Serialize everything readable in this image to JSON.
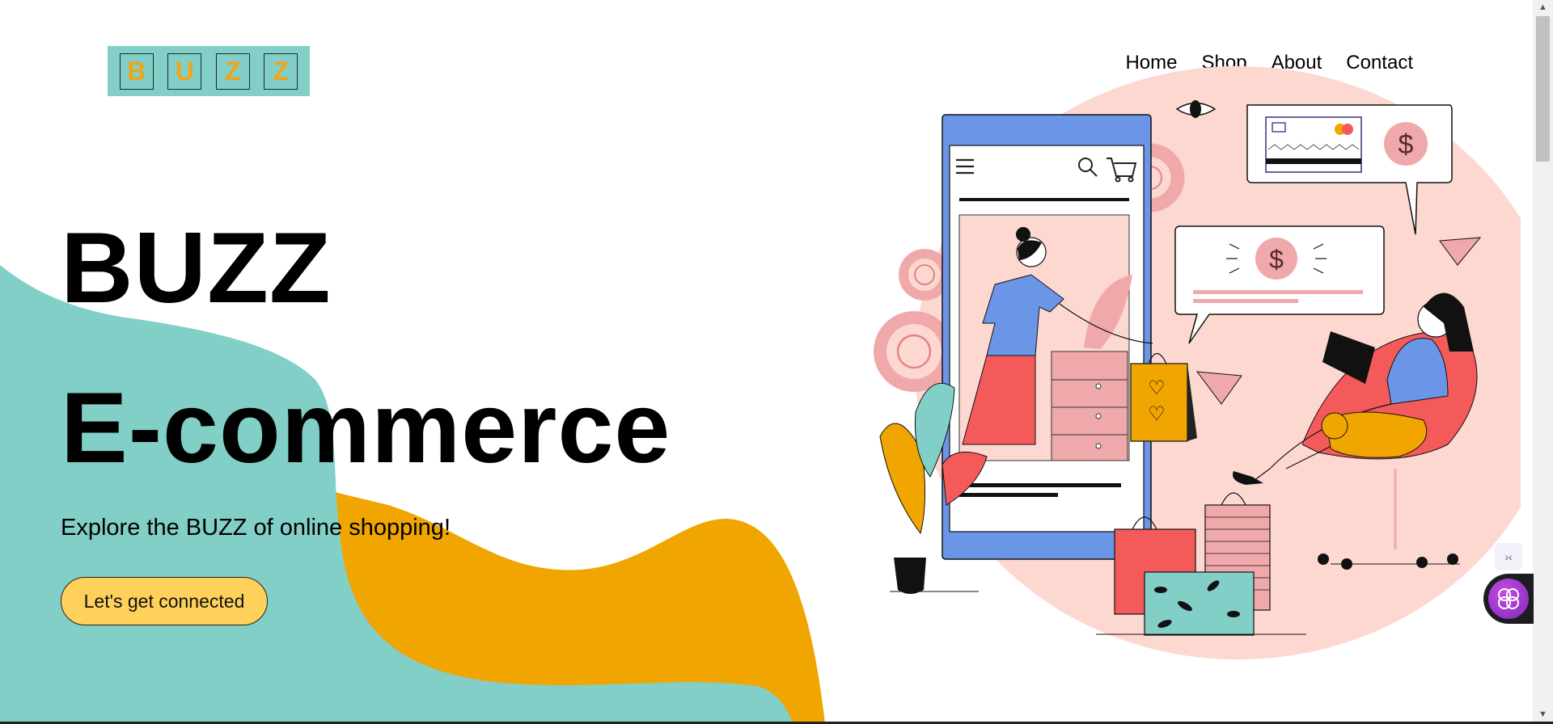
{
  "brand": {
    "logo_letters": [
      "B",
      "U",
      "Z",
      "Z"
    ]
  },
  "nav": {
    "items": [
      "Home",
      "Shop",
      "About",
      "Contact"
    ]
  },
  "hero": {
    "title_line1": "BUZZ",
    "title_line2": "E-commerce",
    "subtitle": "Explore the BUZZ of online shopping!",
    "cta_label": "Let's get connected"
  },
  "illustration": {
    "icons": [
      "eye-icon",
      "credit-card-icon",
      "dollar-icon",
      "search-icon",
      "cart-icon",
      "menu-icon",
      "paper-plane-icon"
    ],
    "price_symbol": "$"
  },
  "colors": {
    "teal": "#82cfc8",
    "orange": "#f0a500",
    "button_yellow": "#ffd15a",
    "pink_circle": "#fdd8d1",
    "phone_blue": "#6b96e8",
    "coral": "#f55a5a",
    "salmon": "#f0a9aa"
  },
  "scrollbar": {
    "up_glyph": "▲",
    "down_glyph": "▼"
  },
  "extension": {
    "small_glyph": "›‹"
  }
}
